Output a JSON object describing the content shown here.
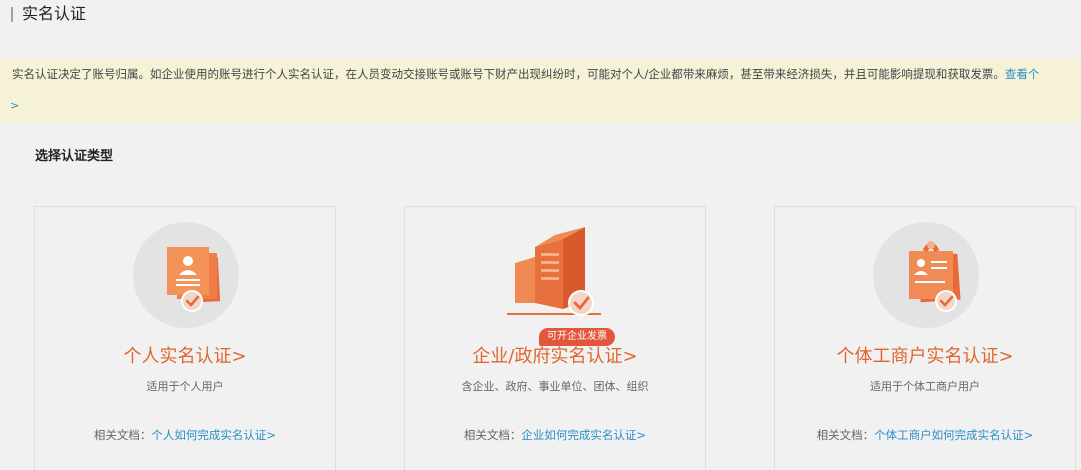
{
  "page": {
    "title": "实名认证"
  },
  "notice": {
    "text": "实名认证决定了账号归属。如企业使用的账号进行个人实名认证，在人员变动交接账号或账号下财产出现纠纷时，可能对个人/企业都带来麻烦，甚至带来经济损失，并且可能影响提现和获取发票。",
    "link_label": "查看个",
    "arrow": ">"
  },
  "section": {
    "title": "选择认证类型"
  },
  "cards": [
    {
      "title": "个人实名认证>",
      "subtitle": "适用于个人用户",
      "doc_prefix": "相关文档：",
      "doc_link": "个人如何完成实名认证>"
    },
    {
      "title": "企业/政府实名认证>",
      "subtitle": "含企业、政府、事业单位、团体、组织",
      "badge": "可开企业发票",
      "doc_prefix": "相关文档：",
      "doc_link": "企业如何完成实名认证>"
    },
    {
      "title": "个体工商户实名认证>",
      "subtitle": "适用于个体工商户用户",
      "doc_prefix": "相关文档：",
      "doc_link": "个体工商户如何完成实名认证>"
    }
  ],
  "colors": {
    "accent_orange": "#e0662e",
    "link_blue": "#2a90c9",
    "notice_bg": "#f5f2d8",
    "badge_red": "#e2563b"
  },
  "icons": [
    "id-card-check-icon",
    "building-check-icon",
    "business-license-check-icon"
  ]
}
